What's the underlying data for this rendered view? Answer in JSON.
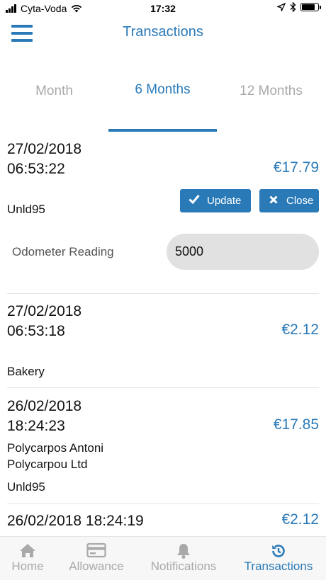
{
  "status_bar": {
    "carrier": "Cyta-Voda",
    "time": "17:32",
    "battery_level": 0.85
  },
  "header": {
    "title": "Transactions"
  },
  "period_tabs": [
    {
      "label": "Month",
      "active": false
    },
    {
      "label": "6 Months",
      "active": true
    },
    {
      "label": "12 Months",
      "active": false
    }
  ],
  "transactions": [
    {
      "date": "27/02/2018",
      "time": "06:53:22",
      "amount": "€17.79",
      "product": "Unld95"
    },
    {
      "date": "27/02/2018",
      "time": "06:53:18",
      "amount": "€2.12",
      "product": "Bakery"
    },
    {
      "date": "26/02/2018",
      "time": "18:24:23",
      "amount": "€17.85",
      "merchant_line1": "Polycarpos Antoni",
      "merchant_line2": "Polycarpou Ltd",
      "product": "Unld95"
    },
    {
      "datetime": "26/02/2018 18:24:19",
      "amount": "€2.12"
    }
  ],
  "edit_panel": {
    "update_label": "Update",
    "close_label": "Close",
    "odometer_label": "Odometer Reading",
    "odometer_value": "5000"
  },
  "tabbar": [
    {
      "label": "Home",
      "icon": "home-icon",
      "active": false
    },
    {
      "label": "Allowance",
      "icon": "card-icon",
      "active": false
    },
    {
      "label": "Notifications",
      "icon": "bell-icon",
      "active": false
    },
    {
      "label": "Transactions",
      "icon": "history-icon",
      "active": true
    }
  ],
  "colors": {
    "accent": "#2a7ab8",
    "inactive": "#a9a9a9",
    "input_bg": "#e1e1e1"
  }
}
